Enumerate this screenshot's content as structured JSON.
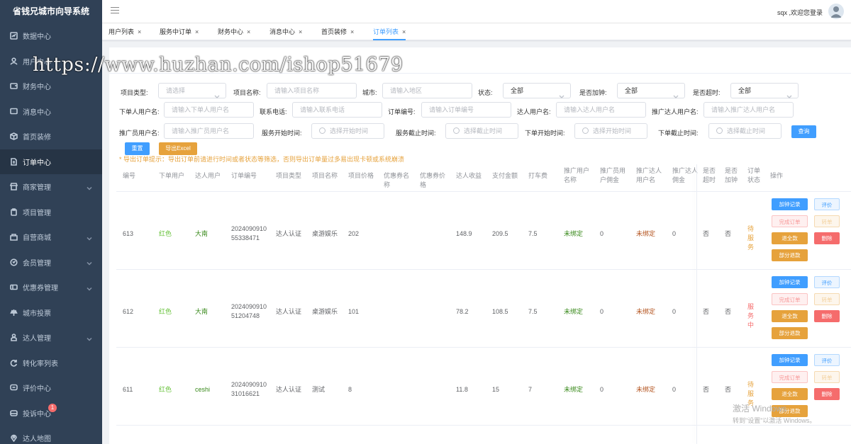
{
  "app": {
    "title": "省钱兄城市向导系统"
  },
  "sidebar": {
    "items": [
      {
        "label": "数据中心",
        "icon": "chart-icon",
        "caret": false
      },
      {
        "label": "用户中心",
        "icon": "user-icon",
        "caret": false
      },
      {
        "label": "财务中心",
        "icon": "wallet-icon",
        "caret": false
      },
      {
        "label": "消息中心",
        "icon": "message-icon",
        "caret": false
      },
      {
        "label": "首页装修",
        "icon": "cube-icon",
        "caret": false
      },
      {
        "label": "订单中心",
        "icon": "document-icon",
        "caret": false,
        "active": true
      },
      {
        "label": "商家管理",
        "icon": "shop-icon",
        "caret": true
      },
      {
        "label": "项目管理",
        "icon": "clipboard-icon",
        "caret": false
      },
      {
        "label": "自营商城",
        "icon": "store-icon",
        "caret": true
      },
      {
        "label": "会员管理",
        "icon": "member-icon",
        "caret": true
      },
      {
        "label": "优惠券管理",
        "icon": "coupon-icon",
        "caret": true
      },
      {
        "label": "城市投票",
        "icon": "vote-icon",
        "caret": false
      },
      {
        "label": "达人管理",
        "icon": "person-icon",
        "caret": true
      },
      {
        "label": "转化率列表",
        "icon": "refresh-icon",
        "caret": false
      },
      {
        "label": "评价中心",
        "icon": "comment-icon",
        "caret": false
      },
      {
        "label": "投诉中心",
        "icon": "complaint-icon",
        "caret": false,
        "badge": "1"
      },
      {
        "label": "达人地图",
        "icon": "location-icon",
        "caret": false
      }
    ]
  },
  "topbar": {
    "welcome": "sqx ,欢迎您登录"
  },
  "tabs": [
    {
      "label": "用户列表"
    },
    {
      "label": "服务中订单"
    },
    {
      "label": "财务中心"
    },
    {
      "label": "消息中心"
    },
    {
      "label": "首页装修"
    },
    {
      "label": "订单列表",
      "active": true
    }
  ],
  "close_glyph": "×",
  "filters": {
    "project_type": {
      "label": "项目类型:",
      "placeholder": "请选择"
    },
    "project_name": {
      "label": "项目名称:",
      "placeholder": "请输入项目名称"
    },
    "city": {
      "label": "城市:",
      "placeholder": "请输入地区"
    },
    "status": {
      "label": "状态:",
      "value": "全部"
    },
    "add_clock": {
      "label": "是否加钟:",
      "value": "全部"
    },
    "overtime": {
      "label": "是否超时:",
      "value": "全部"
    },
    "order_user": {
      "label": "下单人用户名:",
      "placeholder": "请输入下单人用户名"
    },
    "phone": {
      "label": "联系电话:",
      "placeholder": "请输入联系电话"
    },
    "order_no": {
      "label": "订单编号:",
      "placeholder": "请输入订单编号"
    },
    "expert_user": {
      "label": "达人用户名:",
      "placeholder": "请输入达人用户名"
    },
    "promoter_expert": {
      "label": "推广达人用户名:",
      "placeholder": "请输入推广达人用户名"
    },
    "promoter_user": {
      "label": "推广员用户名:",
      "placeholder": "请输入推广员用户名"
    },
    "service_start": {
      "label": "服务开始时间:",
      "placeholder": "选择开始时间"
    },
    "service_end": {
      "label": "服务截止时间:",
      "placeholder": "选择截止时间"
    },
    "order_start": {
      "label": "下单开始时间:",
      "placeholder": "选择开始时间"
    },
    "order_end": {
      "label": "下单截止时间:",
      "placeholder": "选择截止时间"
    }
  },
  "buttons": {
    "query": "查询",
    "reset": "重置",
    "export": "导出Excel"
  },
  "tip": "* 导出订单提示：导出订单前请进行时间或者状态等筛选，否则导出订单量过多易出现卡顿或系统崩溃",
  "table": {
    "headers": [
      "编号",
      "下单用户",
      "达人用户",
      "订单编号",
      "项目类型",
      "项目名称",
      "项目价格",
      "优惠券名称",
      "优惠券价格",
      "达人收益",
      "支付金额",
      "打车费",
      "推广用户名称",
      "推广员用户佣金",
      "推广达人用户名",
      "推广达人佣金",
      "是否超时",
      "是否加钟",
      "订单状态",
      "操作"
    ],
    "rows": [
      {
        "id": "613",
        "buyer": "红色",
        "expert": "大南",
        "order_no": "2024090910 55338471",
        "type": "达人认证",
        "name": "桌游娱乐",
        "price": "202",
        "coupon_name": "",
        "coupon_price": "",
        "income": "148.9",
        "pay": "209.5",
        "taxi": "7.5",
        "promoter": "未绑定",
        "promoter_fee": "0",
        "promo_expert": "未绑定",
        "promo_expert_fee": "0",
        "overtime": "否",
        "add_clock": "否",
        "status": "待服务",
        "status_color": "orange"
      },
      {
        "id": "612",
        "buyer": "红色",
        "expert": "大南",
        "order_no": "2024090910 51204748",
        "type": "达人认证",
        "name": "桌游娱乐",
        "price": "101",
        "coupon_name": "",
        "coupon_price": "",
        "income": "78.2",
        "pay": "108.5",
        "taxi": "7.5",
        "promoter": "未绑定",
        "promoter_fee": "0",
        "promo_expert": "未绑定",
        "promo_expert_fee": "0",
        "overtime": "否",
        "add_clock": "否",
        "status": "服务中",
        "status_color": "red"
      },
      {
        "id": "611",
        "buyer": "红色",
        "expert": "ceshi",
        "order_no": "2024090910 31016621",
        "type": "达人认证",
        "name": "测试",
        "price": "8",
        "coupon_name": "",
        "coupon_price": "",
        "income": "11.8",
        "pay": "15",
        "taxi": "7",
        "promoter": "未绑定",
        "promoter_fee": "0",
        "promo_expert": "未绑定",
        "promo_expert_fee": "0",
        "overtime": "否",
        "add_clock": "否",
        "status": "待服务",
        "status_color": "orange"
      }
    ],
    "actions": {
      "add_record": "加钟记录",
      "review": "评价",
      "complete": "完成订单",
      "transfer": "转单",
      "full_refund": "退全款",
      "delete": "删除",
      "partial_refund": "部分退款"
    }
  },
  "watermark": "https://www.huzhan.com/ishop51679",
  "activation": {
    "line1": "激活 Windows",
    "line2": "转到\"设置\"以激活 Windows。"
  }
}
